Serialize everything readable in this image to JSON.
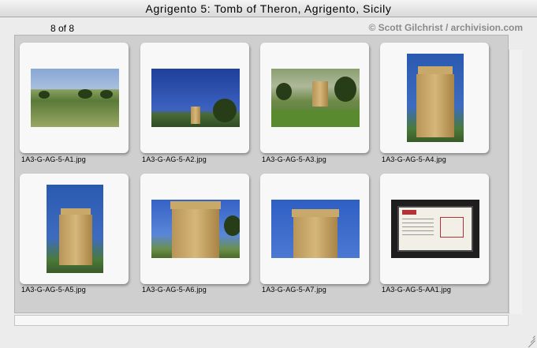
{
  "window": {
    "title": "Agrigento 5: Tomb of Theron, Agrigento, Sicily",
    "counter": "8 of 8",
    "credit": "© Scott Gilchrist / archivision.com"
  },
  "images": [
    {
      "filename": "1A3-G-AG-5-A1.jpg"
    },
    {
      "filename": "1A3-G-AG-5-A2.jpg"
    },
    {
      "filename": "1A3-G-AG-5-A3.jpg"
    },
    {
      "filename": "1A3-G-AG-5-A4.jpg"
    },
    {
      "filename": "1A3-G-AG-5-A5.jpg"
    },
    {
      "filename": "1A3-G-AG-5-A6.jpg"
    },
    {
      "filename": "1A3-G-AG-5-A7.jpg"
    },
    {
      "filename": "1A3-G-AG-5-AA1.jpg"
    }
  ]
}
